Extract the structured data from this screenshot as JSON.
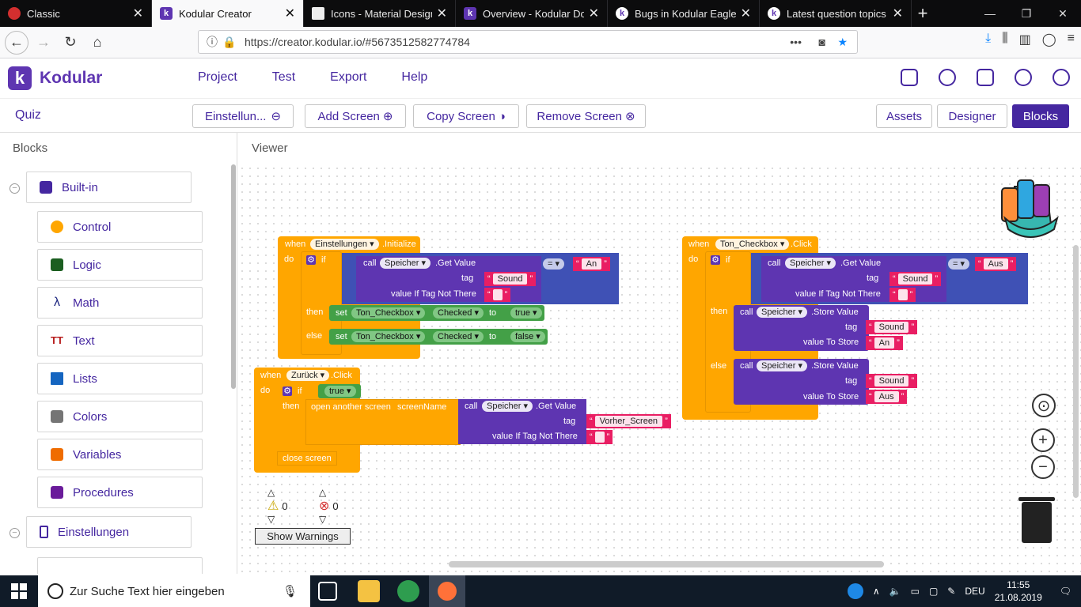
{
  "browser": {
    "tabs": [
      {
        "title": "Classic"
      },
      {
        "title": "Kodular Creator"
      },
      {
        "title": "Icons - Material Design"
      },
      {
        "title": "Overview - Kodular Docs"
      },
      {
        "title": "Bugs in Kodular Eagle - F"
      },
      {
        "title": "Latest question topics - K"
      }
    ],
    "url": "https://creator.kodular.io/#5673512582774784",
    "url_domain": "kodular.io"
  },
  "app": {
    "brand": "Kodular",
    "menu": [
      "Project",
      "Test",
      "Export",
      "Help"
    ],
    "project": "Quiz",
    "screen_select": "Einstellun...",
    "add_screen": "Add Screen",
    "copy_screen": "Copy Screen",
    "remove_screen": "Remove Screen",
    "assets": "Assets",
    "designer": "Designer",
    "blocks": "Blocks"
  },
  "sidebar": {
    "header": "Blocks",
    "builtin": "Built-in",
    "items": [
      "Control",
      "Logic",
      "Math",
      "Text",
      "Lists",
      "Colors",
      "Variables",
      "Procedures"
    ],
    "screen": "Einstellungen"
  },
  "viewer": {
    "header": "Viewer",
    "warnings_count": "0",
    "errors_count": "0",
    "show_warnings": "Show Warnings",
    "blocks": {
      "b1_when": "when",
      "b1_comp": "Einstellungen",
      "b1_event": ".Initialize",
      "do": "do",
      "if": "if",
      "call": "call",
      "speicher": "Speicher",
      "getvalue": ".Get Value",
      "tag": "tag",
      "vitnt": "value If Tag Not There",
      "sound": "Sound",
      "an": "An",
      "aus": "Aus",
      "eq": "=",
      "then": "then",
      "else": "else",
      "set": "set",
      "ton_checkbox": "Ton_Checkbox",
      "checked": "Checked",
      "to": "to",
      "true": "true",
      "false": "false",
      "b2_comp": "Zurück",
      "b2_event": ".Click",
      "open_screen": "open another screen",
      "screen_name": "screenName",
      "vorher": "Vorher_Screen",
      "close_screen": "close screen",
      "b3_comp": "Ton_Checkbox",
      "b3_event": ".Click",
      "storevalue": ".Store Value",
      "vts": "value To Store"
    }
  },
  "taskbar": {
    "search_placeholder": "Zur Suche Text hier eingeben",
    "lang": "DEU",
    "time": "11:55",
    "date": "21.08.2019"
  },
  "colors": {
    "brand": "#5e35b1",
    "event_block": "#ffa600",
    "component_block": "#5e35b1",
    "text_block": "#e91e63",
    "setter_block": "#43a047",
    "logic_block": "#3f51b5"
  }
}
